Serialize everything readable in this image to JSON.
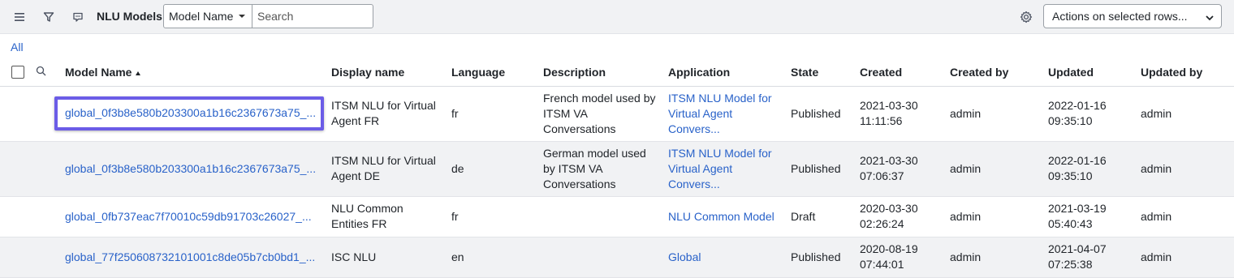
{
  "header": {
    "title": "NLU Models",
    "search_field": "Model Name",
    "search_placeholder": "Search",
    "actions": "Actions on selected rows..."
  },
  "breadcrumb": "All",
  "columns": [
    "Model Name",
    "Display name",
    "Language",
    "Description",
    "Application",
    "State",
    "Created",
    "Created by",
    "Updated",
    "Updated by"
  ],
  "rows": [
    {
      "model_name": "global_0f3b8e580b203300a1b16c2367673a75_...",
      "display_name": "ITSM NLU for Virtual Agent FR",
      "language": "fr",
      "description": "French model used by ITSM VA Conversations",
      "application": "ITSM NLU Model for Virtual Agent Convers...",
      "state": "Published",
      "created_date": "2021-03-30",
      "created_time": "11:11:56",
      "created_by": "admin",
      "updated_date": "2022-01-16",
      "updated_time": "09:35:10",
      "updated_by": "admin"
    },
    {
      "model_name": "global_0f3b8e580b203300a1b16c2367673a75_...",
      "display_name": "ITSM NLU for Virtual Agent DE",
      "language": "de",
      "description": "German model used by ITSM VA Conversations",
      "application": "ITSM NLU Model for Virtual Agent Convers...",
      "state": "Published",
      "created_date": "2021-03-30",
      "created_time": "07:06:37",
      "created_by": "admin",
      "updated_date": "2022-01-16",
      "updated_time": "09:35:10",
      "updated_by": "admin"
    },
    {
      "model_name": "global_0fb737eac7f70010c59db91703c26027_...",
      "display_name": "NLU Common Entities FR",
      "language": "fr",
      "description": "",
      "application": "NLU Common Model",
      "state": "Draft",
      "created_date": "2020-03-30",
      "created_time": "02:26:24",
      "created_by": "admin",
      "updated_date": "2021-03-19",
      "updated_time": "05:40:43",
      "updated_by": "admin"
    },
    {
      "model_name": "global_77f250608732101001c8de05b7cb0bd1_...",
      "display_name": "ISC NLU",
      "language": "en",
      "description": "",
      "application": "Global",
      "state": "Published",
      "created_date": "2020-08-19",
      "created_time": "07:44:01",
      "created_by": "admin",
      "updated_date": "2021-04-07",
      "updated_time": "07:25:38",
      "updated_by": "admin"
    }
  ],
  "icons": {
    "menu": "hamburger-menu-icon",
    "filter": "funnel-icon",
    "chat": "chat-bubble-icon",
    "search": "magnifier-icon",
    "settings": "gear-icon"
  },
  "colors": {
    "link": "#2962c9",
    "highlight": "#6b5ce7",
    "header_bg": "#f1f2f4"
  }
}
